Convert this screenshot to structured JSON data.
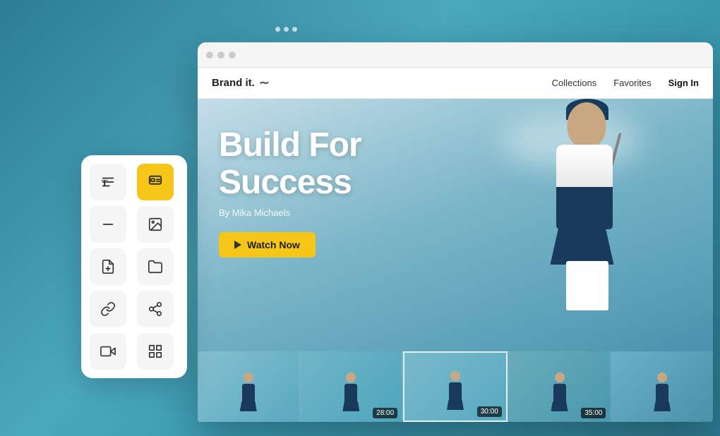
{
  "background": {
    "color": "#3a8fa3"
  },
  "three_dots": [
    "●",
    "●",
    "●"
  ],
  "browser": {
    "dots": [
      "dot1",
      "dot2",
      "dot3"
    ]
  },
  "site": {
    "logo": "Brand it.",
    "logo_mark": "∼",
    "nav_links": [
      {
        "label": "Collections",
        "id": "collections"
      },
      {
        "label": "Favorites",
        "id": "favorites"
      },
      {
        "label": "Sign In",
        "id": "sign-in"
      }
    ]
  },
  "hero": {
    "title_line1": "Build For",
    "title_line2": "Success",
    "subtitle": "By Mika Michaels",
    "watch_button_label": "Watch Now"
  },
  "thumbnails": [
    {
      "duration": ""
    },
    {
      "duration": "28:00"
    },
    {
      "duration": "30:00"
    },
    {
      "duration": "35:00"
    },
    {
      "duration": ""
    }
  ],
  "toolbar": {
    "buttons": [
      {
        "id": "text",
        "icon": "text",
        "active": false,
        "label": "Text"
      },
      {
        "id": "layers",
        "icon": "layers",
        "active": true,
        "label": "Layers"
      },
      {
        "id": "minus",
        "icon": "minus",
        "active": false,
        "label": "Minus"
      },
      {
        "id": "image",
        "icon": "image",
        "active": false,
        "label": "Image"
      },
      {
        "id": "file",
        "icon": "file",
        "active": false,
        "label": "File"
      },
      {
        "id": "folder",
        "icon": "folder",
        "active": false,
        "label": "Folder"
      },
      {
        "id": "link",
        "icon": "link",
        "active": false,
        "label": "Link"
      },
      {
        "id": "share",
        "icon": "share",
        "active": false,
        "label": "Share"
      },
      {
        "id": "video",
        "icon": "video",
        "active": false,
        "label": "Video"
      },
      {
        "id": "grid",
        "icon": "grid",
        "active": false,
        "label": "Grid"
      }
    ]
  }
}
